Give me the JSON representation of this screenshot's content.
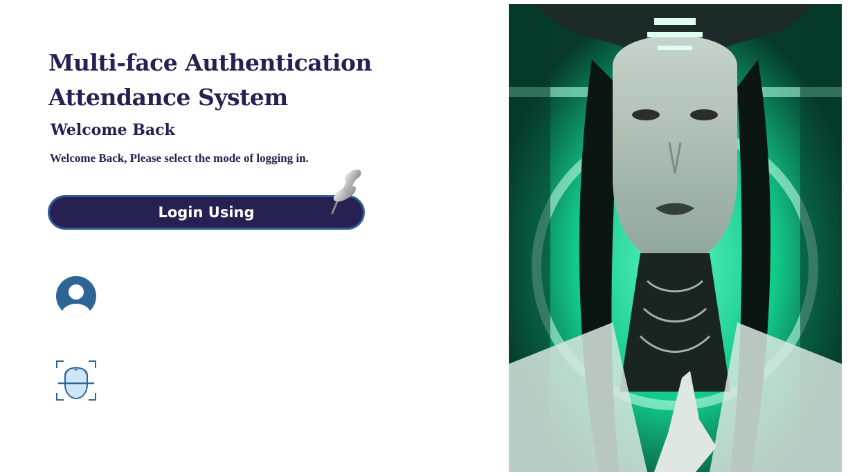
{
  "header": {
    "title": "Multi-face Authentication Attendance System",
    "subtitle": "Welcome Back",
    "description": "Welcome Back, Please select the mode of logging in."
  },
  "login": {
    "button_label": "Login Using"
  },
  "login_options": [
    {
      "icon": "user-icon"
    },
    {
      "icon": "face-scan-icon"
    }
  ],
  "decorations": {
    "pin": "pushpin-icon",
    "photo": "cyber-portrait-image"
  },
  "colors": {
    "primary": "#272052",
    "button_border": "#2f5e93",
    "icon_blue": "#2e6594",
    "accent_green": "#1fd99a"
  }
}
